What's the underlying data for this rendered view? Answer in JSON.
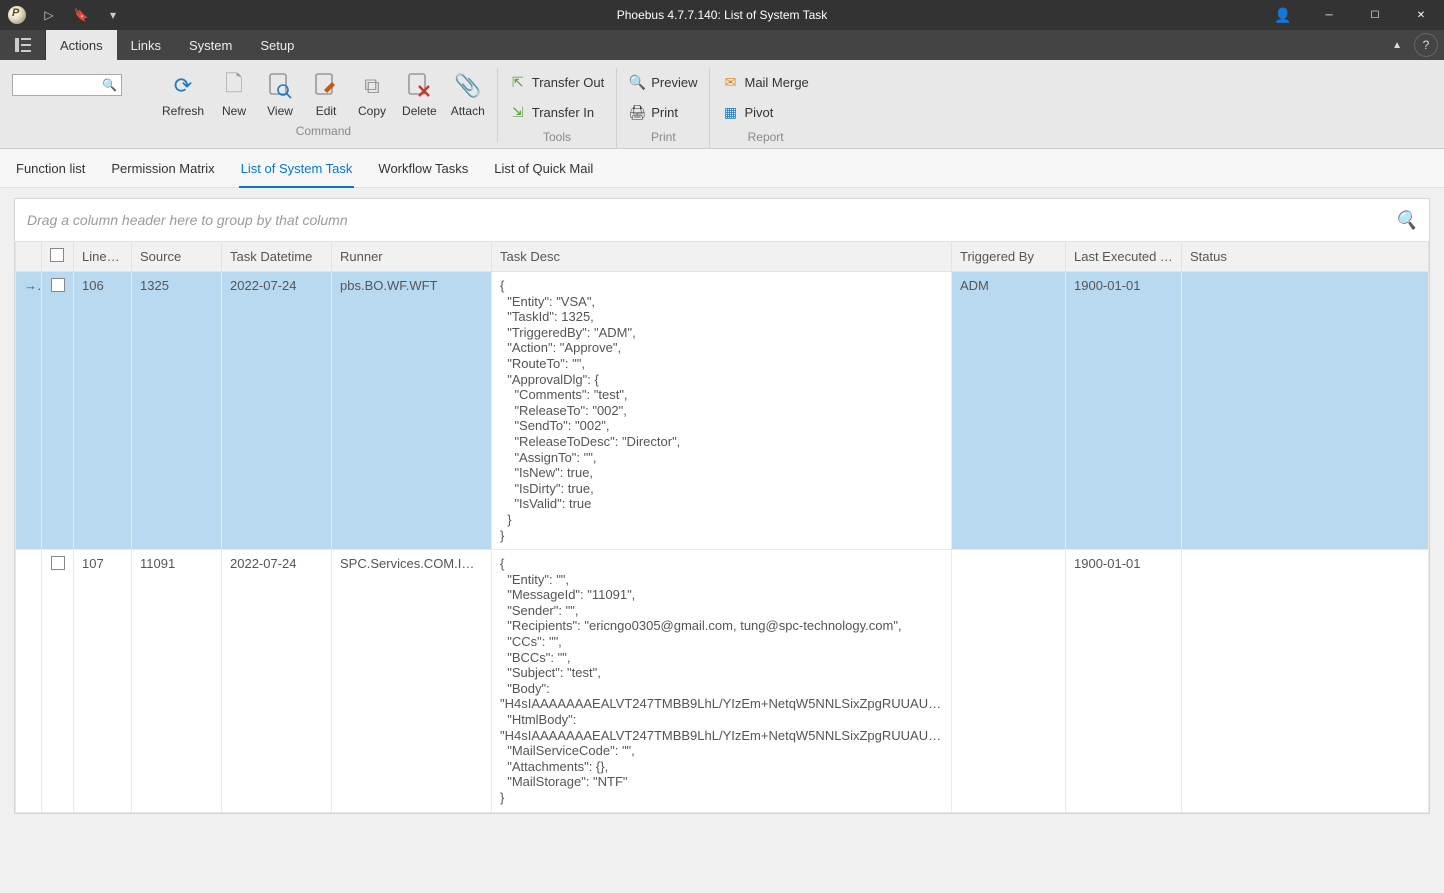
{
  "title": "Phoebus 4.7.7.140: List of System Task",
  "menu": {
    "items": [
      "Actions",
      "Links",
      "System",
      "Setup"
    ],
    "active": 0
  },
  "ribbon": {
    "command": {
      "label": "Command",
      "buttons": [
        "Refresh",
        "New",
        "View",
        "Edit",
        "Copy",
        "Delete",
        "Attach"
      ]
    },
    "tools": {
      "label": "Tools",
      "items": [
        "Transfer Out",
        "Transfer In"
      ]
    },
    "print": {
      "label": "Print",
      "items": [
        "Preview",
        "Print"
      ]
    },
    "report": {
      "label": "Report",
      "items": [
        "Mail Merge",
        "Pivot"
      ]
    }
  },
  "doc_tabs": {
    "items": [
      "Function list",
      "Permission Matrix",
      "List of System Task",
      "Workflow Tasks",
      "List of Quick Mail"
    ],
    "active": 2
  },
  "group_panel_hint": "Drag a column header here to group by that column",
  "columns": {
    "line": "Line#",
    "source": "Source",
    "datetime": "Task Datetime",
    "runner": "Runner",
    "desc": "Task Desc",
    "triggered": "Triggered By",
    "last": "Last Executed Ti...",
    "status": "Status"
  },
  "rows": [
    {
      "selected": true,
      "indicator": "→",
      "line": "106",
      "source": "1325",
      "datetime": "2022-07-24",
      "runner": "pbs.BO.WF.WFT",
      "desc": "{\n  \"Entity\": \"VSA\",\n  \"TaskId\": 1325,\n  \"TriggeredBy\": \"ADM\",\n  \"Action\": \"Approve\",\n  \"RouteTo\": \"\",\n  \"ApprovalDlg\": {\n    \"Comments\": \"test\",\n    \"ReleaseTo\": \"002\",\n    \"SendTo\": \"002\",\n    \"ReleaseToDesc\": \"Director\",\n    \"AssignTo\": \"\",\n    \"IsNew\": true,\n    \"IsDirty\": true,\n    \"IsValid\": true\n  }\n}",
      "triggered": "ADM",
      "last": "1900-01-01",
      "status": ""
    },
    {
      "selected": false,
      "indicator": "",
      "line": "107",
      "source": "11091",
      "datetime": "2022-07-24",
      "runner": "SPC.Services.COM.ISend...",
      "desc": "{\n  \"Entity\": \"\",\n  \"MessageId\": \"11091\",\n  \"Sender\": \"\",\n  \"Recipients\": \"ericngo0305@gmail.com, tung@spc-technology.com\",\n  \"CCs\": \"\",\n  \"BCCs\": \"\",\n  \"Subject\": \"test\",\n  \"Body\":\n\"H4sIAAAAAAAEALVT247TMBB9LhL/YIzEm+NetqW5NNLSixZpgRUUAU+rSeImFo...\",\n  \"HtmlBody\":\n\"H4sIAAAAAAAEALVT247TMBB9LhL/YIzEm+NetqW5NNLSixZpgRUUAU+rSeImFo...\",\n  \"MailServiceCode\": \"\",\n  \"Attachments\": {},\n  \"MailStorage\": \"NTF\"\n}",
      "triggered": "",
      "last": "1900-01-01",
      "status": ""
    }
  ]
}
